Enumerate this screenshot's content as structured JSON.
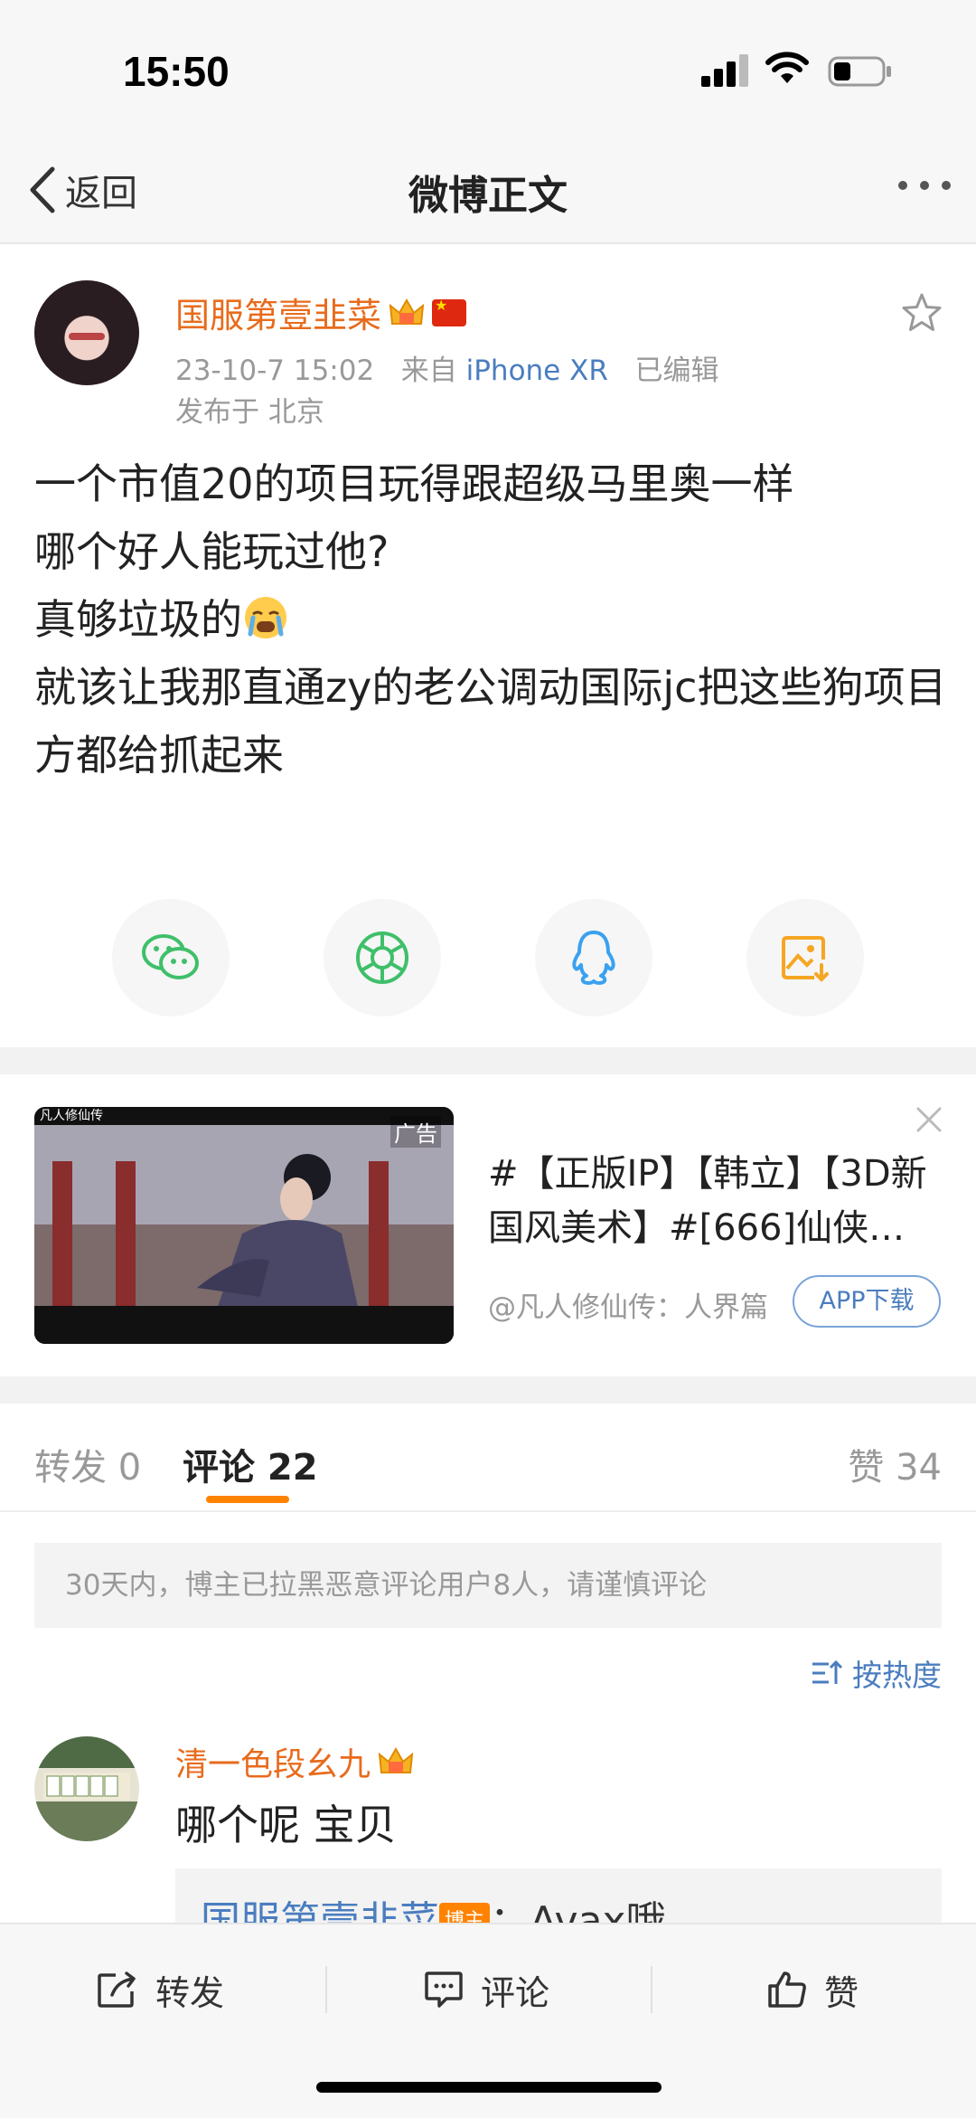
{
  "status_bar": {
    "time": "15:50"
  },
  "nav": {
    "back_label": "返回",
    "title": "微博正文"
  },
  "post": {
    "author": "国服第壹韭菜",
    "date": "23-10-7 15:02",
    "source_prefix": "来自",
    "source": "iPhone XR",
    "edited": "已编辑",
    "location": "发布于 北京",
    "lines": [
      "一个市值20的项目玩得跟超级马里奥一样",
      "哪个好人能玩过他?",
      "真够垃圾的",
      "就该让我那直通zy的老公调动国际jc把这些狗项目方都给抓起来"
    ]
  },
  "share": [
    {
      "icon": "wechat-icon",
      "color": "#3fbf6a"
    },
    {
      "icon": "moments-icon",
      "color": "#3fbf6a"
    },
    {
      "icon": "qq-icon",
      "color": "#3aa1f0"
    },
    {
      "icon": "save-image-icon",
      "color": "#f5a623"
    }
  ],
  "ad": {
    "image_text": "凡人修仙传",
    "tag": "广告",
    "title": "#【正版IP】【韩立】【3D新国风美术】#[666]仙侠…",
    "source": "@凡人修仙传：人界篇",
    "download_label": "APP下载"
  },
  "tabs": {
    "repost": "转发 0",
    "comment": "评论 22",
    "like": "赞 34"
  },
  "notice": "30天内，博主已拉黑恶意评论用户8人，请谨慎评论",
  "sort_label": "按热度",
  "comment": {
    "author": "清一色段幺九",
    "text": "哪个呢 宝贝",
    "reply_author": "国服第壹韭菜",
    "reply_badge": "博主",
    "reply_text": "：Avax哦"
  },
  "bottom_bar": {
    "repost": "转发",
    "comment": "评论",
    "like": "赞"
  },
  "colors": {
    "accent_orange": "#ff8200",
    "name_orange": "#e86b1c",
    "link_blue": "#4a7dbf"
  }
}
